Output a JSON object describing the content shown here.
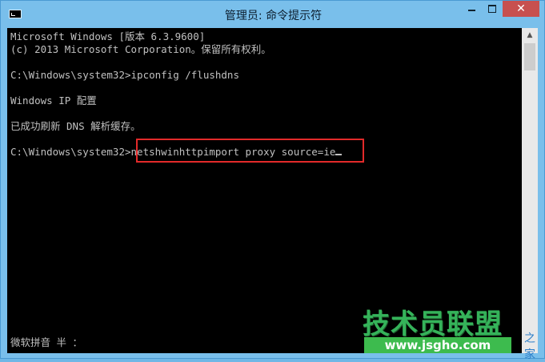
{
  "window": {
    "title": "管理员: 命令提示符",
    "controls": {
      "minimize": "minimize-icon",
      "maximize": "maximize-icon",
      "close_label": "✕"
    }
  },
  "console": {
    "lines": [
      "Microsoft Windows [版本 6.3.9600]",
      "(c) 2013 Microsoft Corporation。保留所有权利。",
      "",
      "C:\\Windows\\system32>ipconfig /flushdns",
      "",
      "Windows IP 配置",
      "",
      "已成功刷新 DNS 解析缓存。",
      "",
      "C:\\Windows\\system32>netshwinhttpimport proxy source=ie"
    ],
    "ime_status": "微软拼音 半 ："
  },
  "watermark": {
    "title": "技术员联盟",
    "suffix": "之家",
    "url": "www.jsgho.com"
  },
  "colors": {
    "titlebar": "#79bfeb",
    "console_bg": "#000000",
    "console_text": "#c0c0c0",
    "highlight": "#e22a2a",
    "close_button": "#c7504f"
  }
}
